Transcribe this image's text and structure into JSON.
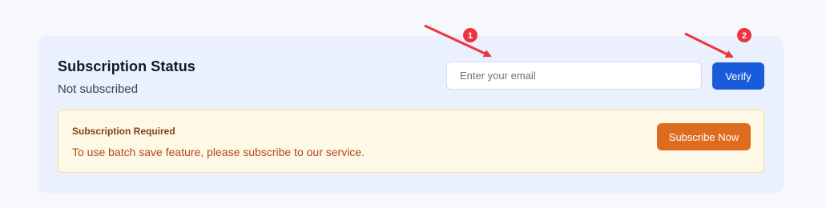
{
  "subscription": {
    "title": "Subscription Status",
    "status": "Not subscribed",
    "email_placeholder": "Enter your email",
    "verify_label": "Verify"
  },
  "notice": {
    "title": "Subscription Required",
    "message": "To use batch save feature, please subscribe to our service.",
    "subscribe_label": "Subscribe Now"
  },
  "annotations": {
    "marker_1": "1",
    "marker_2": "2"
  },
  "colors": {
    "card_bg": "#eaf0fd",
    "verify_bg": "#1a5bdc",
    "subscribe_bg": "#dd6b20",
    "notice_bg": "#fef8e6",
    "notice_border": "#f3dc8a",
    "annotation_red": "#ee3443"
  }
}
